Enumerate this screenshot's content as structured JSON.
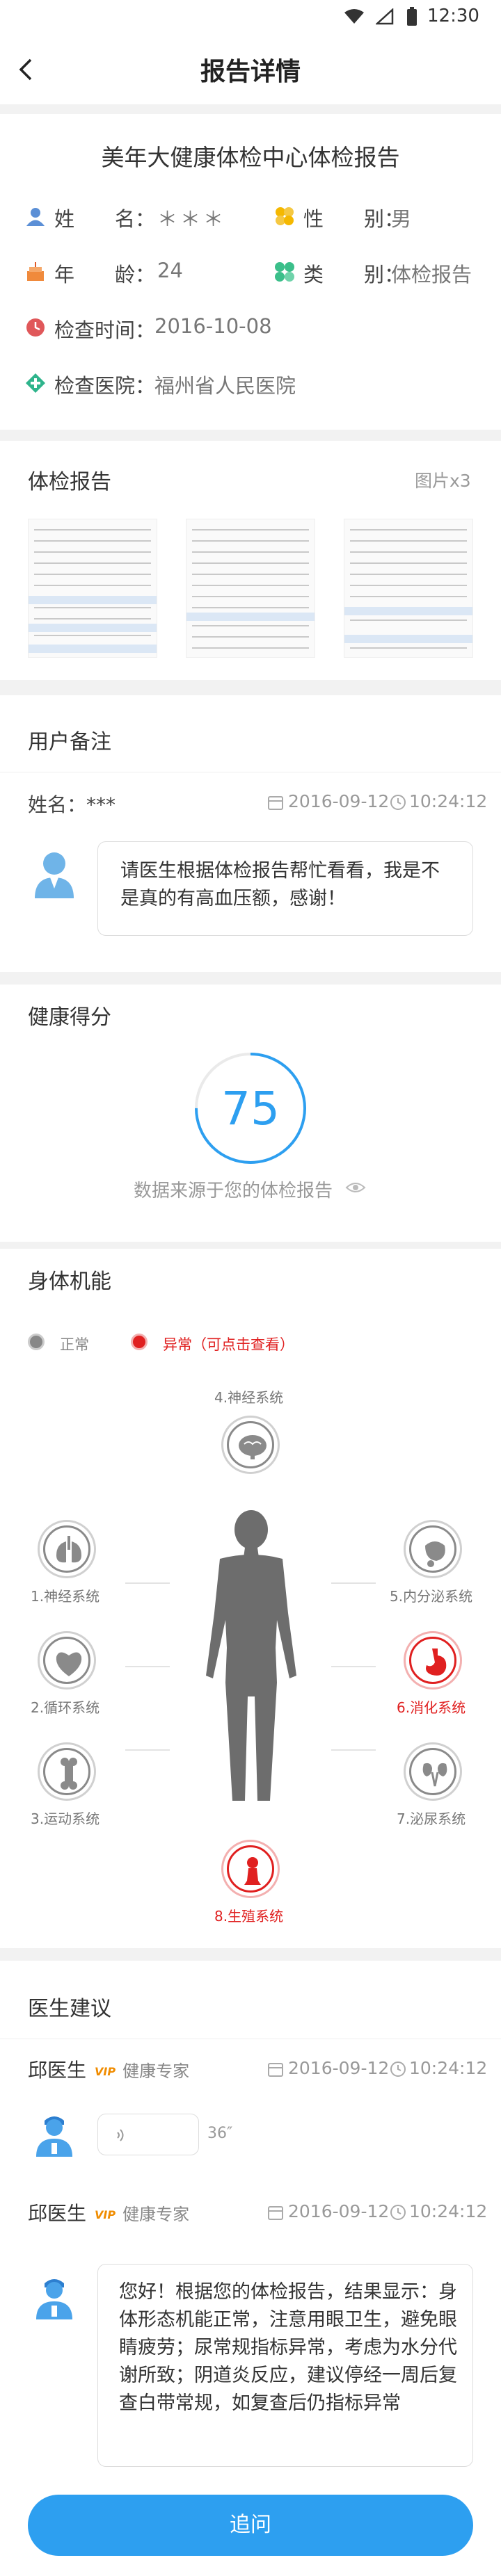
{
  "status_bar": {
    "time": "12:30"
  },
  "header": {
    "title": "报告详情"
  },
  "report": {
    "title": "美年大健康体检中心体检报告",
    "name_label": "姓　　名：",
    "name_value": "＊＊＊",
    "gender_label": "性　　别：",
    "gender_value": "男",
    "age_label": "年　　龄：",
    "age_value": "24",
    "type_label": "类　　别：",
    "type_value": "体检报告",
    "date_label": "检查时间：",
    "date_value": "2016-10-08",
    "hospital_label": "检查医院：",
    "hospital_value": "福州省人民医院"
  },
  "exam_report": {
    "title": "体检报告",
    "count": "图片x3"
  },
  "user_note": {
    "title": "用户备注",
    "name": "姓名：***",
    "date": "2016-09-12",
    "time": "10:24:12",
    "message": "请医生根据体检报告帮忙看看，我是不是真的有高血压额，感谢！"
  },
  "health_score": {
    "title": "健康得分",
    "score": "75",
    "score_fraction": 0.75,
    "source": "数据来源于您的体检报告"
  },
  "body_function": {
    "title": "身体机能",
    "legend_normal": "正常",
    "legend_abnormal": "异常（可点击查看）",
    "systems": {
      "s4": "4.神经系统",
      "s1": "1.神经系统",
      "s2": "2.循环系统",
      "s3": "3.运动系统",
      "s5": "5.内分泌系统",
      "s6": "6.消化系统",
      "s7": "7.泌尿系统",
      "s8": "8.生殖系统"
    },
    "colors": {
      "normal": "#8a8a8a",
      "abnormal": "#e02020"
    }
  },
  "doctor_advice": {
    "title": "医生建议",
    "msg1": {
      "doctor": "邱医生",
      "badge": "VIP",
      "role": "健康专家",
      "date": "2016-09-12",
      "time": "10:24:12",
      "voice_duration": "36″"
    },
    "msg2": {
      "doctor": "邱医生",
      "badge": "VIP",
      "role": "健康专家",
      "date": "2016-09-12",
      "time": "10:24:12",
      "message": "您好！根据您的体检报告，结果显示：身体形态机能正常，注意用眼卫生，避免眼睛疲劳；尿常规指标异常，考虑为水分代谢所致；阴道炎反应，建议停经一周后复查白带常规，如复查后仍指标异常"
    }
  },
  "actions": {
    "follow_up": "追问"
  },
  "colors": {
    "accent": "#2d9ff0",
    "alert": "#e02020"
  }
}
